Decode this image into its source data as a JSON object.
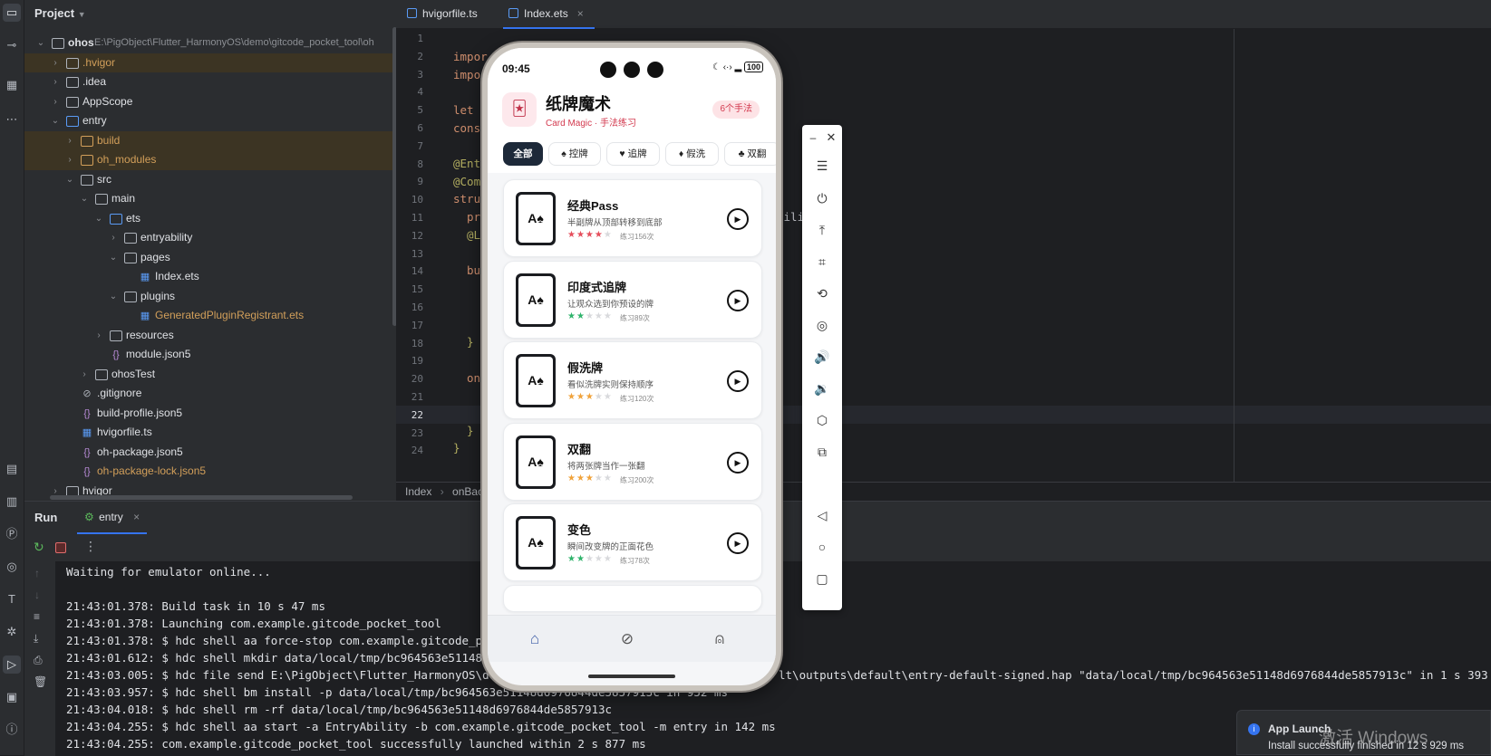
{
  "project": {
    "header": "Project",
    "root_name": "ohos",
    "root_path": "E:\\PigObject\\Flutter_HarmonyOS\\demo\\gitcode_pocket_tool\\oh",
    "tree": [
      {
        "label": ".hvigor"
      },
      {
        "label": ".idea"
      },
      {
        "label": "AppScope"
      },
      {
        "label": "entry"
      },
      {
        "label": "build"
      },
      {
        "label": "oh_modules"
      },
      {
        "label": "src"
      },
      {
        "label": "main"
      },
      {
        "label": "ets"
      },
      {
        "label": "entryability"
      },
      {
        "label": "pages"
      },
      {
        "label": "Index.ets"
      },
      {
        "label": "plugins"
      },
      {
        "label": "GeneratedPluginRegistrant.ets"
      },
      {
        "label": "resources"
      },
      {
        "label": "module.json5"
      },
      {
        "label": "ohosTest"
      },
      {
        "label": ".gitignore"
      },
      {
        "label": "build-profile.json5"
      },
      {
        "label": "hvigorfile.ts"
      },
      {
        "label": "oh-package.json5"
      },
      {
        "label": "oh-package-lock.json5"
      },
      {
        "label": "hvigor"
      }
    ]
  },
  "editor": {
    "tabs": [
      {
        "label": "hvigorfile.ts"
      },
      {
        "label": "Index.ets"
      }
    ],
    "close_glyph": "×",
    "line_numbers": [
      "1",
      "2",
      "3",
      "4",
      "5",
      "6",
      "7",
      "8",
      "9",
      "10",
      "11",
      "12",
      "13",
      "14",
      "15",
      "16",
      "17",
      "18",
      "19",
      "20",
      "21",
      "22",
      "23",
      "24"
    ],
    "code": {
      "l2": "impor",
      "l3": "impo",
      "l5": "let",
      "l6": "cons",
      "l8": "@Ent",
      "l9": "@Com",
      "l10": "stru",
      "l11": "pr",
      "l11b": "bili",
      "l11c": "ext",
      "l12": "@L",
      "l14": "bu",
      "l18": "}",
      "l20": "on",
      "l23": "}",
      "l24": "}"
    },
    "breadcrumb": [
      "Index",
      "onBac"
    ]
  },
  "run": {
    "tab_run": "Run",
    "tab_entry": "entry",
    "console": [
      "Waiting for emulator online...",
      "",
      "21:43:01.378: Build task in 10 s 47 ms",
      "21:43:01.378: Launching com.example.gitcode_pocket_tool",
      "21:43:01.378: $ hdc shell aa force-stop com.example.gitcode_pock",
      "21:43:01.612: $ hdc shell mkdir data/local/tmp/bc964563e51148d6",
      "21:43:03.005: $ hdc file send E:\\PigObject\\Flutter_HarmonyOS\\demo",
      "21:43:03.957: $ hdc shell bm install -p data/local/tmp/bc964563e51148d6976844de5857913c in 952 ms",
      "21:43:04.018: $ hdc shell rm -rf data/local/tmp/bc964563e51148d6976844de5857913c",
      "21:43:04.255: $ hdc shell aa start -a EntryAbility -b com.example.gitcode_pocket_tool -m entry in 142 ms",
      "21:43:04.255: com.example.gitcode_pocket_tool successfully launched within 2 s 877 ms"
    ],
    "console_tail_send": "lt\\outputs\\default\\entry-default-signed.hap \"data/local/tmp/bc964563e51148d6976844de5857913c\" in 1 s 393 ms"
  },
  "phone": {
    "status_time": "09:45",
    "status_battery": "100",
    "app_title": "纸牌魔术",
    "app_subtitle": "Card Magic · 手法练习",
    "badge": "6个手法",
    "chips": [
      {
        "label": "全部"
      },
      {
        "label": "♠ 控牌"
      },
      {
        "label": "♥ 追牌"
      },
      {
        "label": "♦ 假洗"
      },
      {
        "label": "♣ 双翻"
      }
    ],
    "card_face": "A♠",
    "tricks": [
      {
        "title": "经典Pass",
        "desc": "半副牌从顶部转移到底部",
        "stars": "★★★★",
        "empty": "★",
        "count": "练习156次",
        "star_color": "#e54d5b"
      },
      {
        "title": "印度式追牌",
        "desc": "让观众选到你预设的牌",
        "stars": "★★",
        "empty": "★★★",
        "count": "练习89次",
        "star_color": "#2fb36b"
      },
      {
        "title": "假洗牌",
        "desc": "看似洗牌实则保持顺序",
        "stars": "★★★",
        "empty": "★★",
        "count": "练习120次",
        "star_color": "#f0a23a"
      },
      {
        "title": "双翻",
        "desc": "将两张牌当作一张翻",
        "stars": "★★★",
        "empty": "★★",
        "count": "练习200次",
        "star_color": "#f0a23a"
      },
      {
        "title": "变色",
        "desc": "瞬间改变牌的正面花色",
        "stars": "★★",
        "empty": "★★★",
        "count": "练习78次",
        "star_color": "#2fb36b"
      }
    ]
  },
  "toast": {
    "title": "App Launch",
    "message": "Install successfully finished in 12 s 929 ms"
  },
  "watermark": "激活 Windows"
}
